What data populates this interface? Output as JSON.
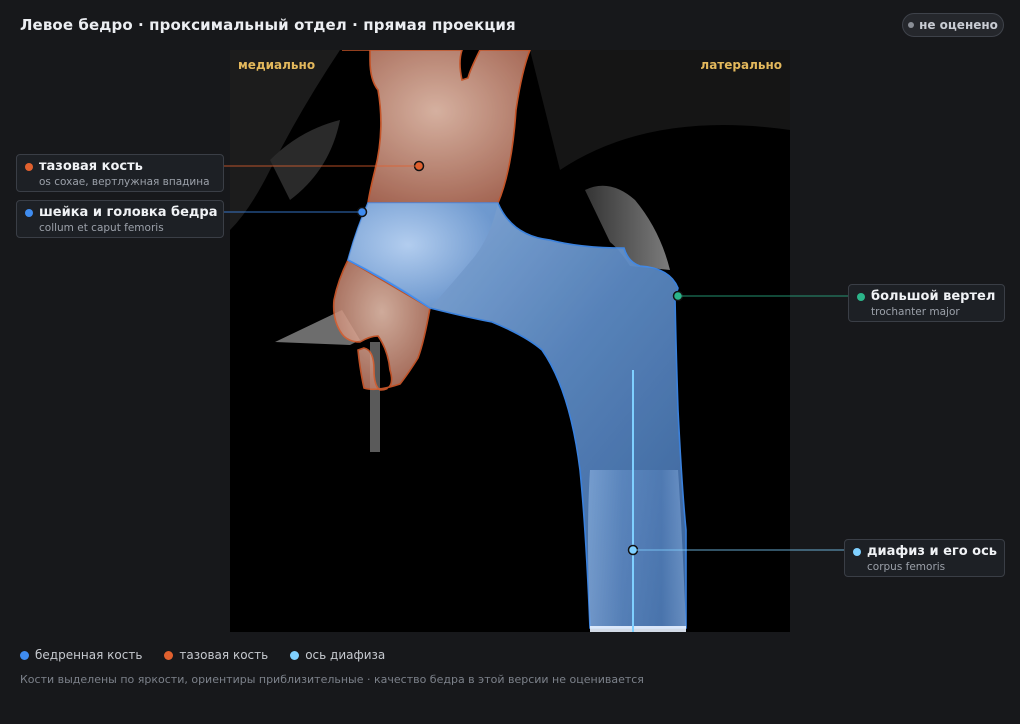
{
  "header": {
    "title": "Левое бедро · проксимальный отдел · прямая проекция",
    "status_badge": "не оценено"
  },
  "viewer": {
    "direction_left": "медиально",
    "direction_right": "латерально"
  },
  "colors": {
    "femur": "#3f8cf0",
    "pelvis": "#e0602e",
    "axis": "#7fd0ff",
    "trochanter": "#2bb58a",
    "direction_label": "#e3b85c"
  },
  "callouts": {
    "pelvis": {
      "name": "тазовая кость",
      "latin": "os coxae, вертлужная впадина"
    },
    "neck": {
      "name": "шейка и головка бедра",
      "latin": "collum et caput femoris"
    },
    "trochanter": {
      "name": "большой вертел",
      "latin": "trochanter major"
    },
    "shaft": {
      "name": "диафиз и его ось",
      "latin": "corpus femoris"
    }
  },
  "legend": {
    "femur": "бедренная кость",
    "pelvis": "тазовая кость",
    "axis": "ось диафиза"
  },
  "footnote": "Кости выделены по яркости, ориентиры приблизительные · качество бедра в этой версии не оценивается"
}
